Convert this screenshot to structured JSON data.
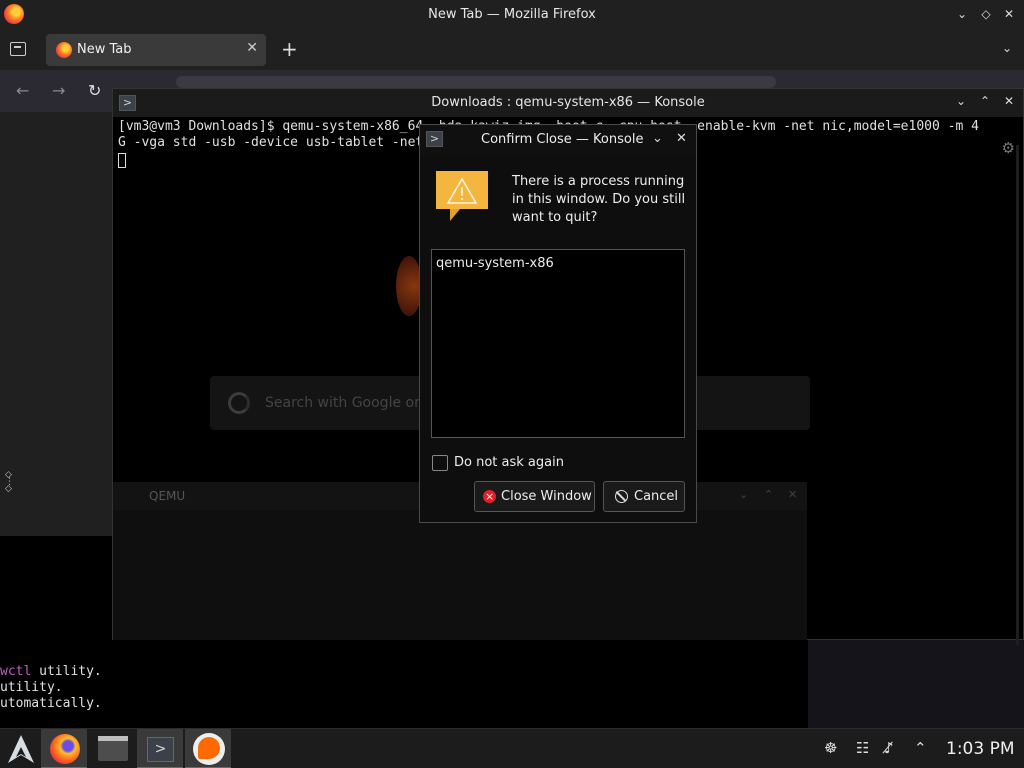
{
  "firefox": {
    "window_title": "New Tab — Mozilla Firefox",
    "controls": {
      "minimize": "⌄",
      "maximize": "◇",
      "close": "✕"
    },
    "tab": {
      "label": "New Tab",
      "close": "✕"
    },
    "new_tab": "+",
    "list_all_tabs": "⌄",
    "nav": {
      "back": "←",
      "forward": "→",
      "reload": "↻"
    },
    "search_placeholder": "Search with Google or"
  },
  "konsole": {
    "title": "Downloads : qemu-system-x86 — Konsole",
    "app_icon": ">",
    "controls": {
      "minimize": "⌄",
      "maximize": "⌃",
      "close": "✕"
    },
    "terminal_lines": [
      "[vm3@vm3 Downloads]$ qemu-system-x86_64 -hda kawiz.img -boot c -cpu host -enable-kvm -net nic,model=e1000 -m 4",
      "G -vga std -usb -device usb-tablet -net"
    ],
    "settings_icon": "⚙"
  },
  "qemu_window": {
    "title": "QEMU",
    "controls": {
      "minimize": "⌄",
      "maximize": "⌃",
      "close": "✕"
    }
  },
  "background_terminal": {
    "lines": [
      {
        "prefix": "wctl",
        "rest": " utility."
      },
      {
        "prefix": "",
        "rest": "utility."
      },
      {
        "prefix": "",
        "rest": "utomatically."
      }
    ]
  },
  "dialog": {
    "title": "Confirm Close — Konsole",
    "app_icon": ">",
    "controls": {
      "minimize": "⌄",
      "close": "✕"
    },
    "message": "There is a process running in this window. Do you still want to quit?",
    "processes": [
      "qemu-system-x86"
    ],
    "checkbox_label": "Do not ask again",
    "checkbox_checked": false,
    "buttons": {
      "close_window": "Close Window",
      "cancel": "Cancel"
    },
    "colors": {
      "warning": "#f5b63f",
      "danger": "#e0202a"
    }
  },
  "taskbar": {
    "apps": [
      {
        "name": "firefox",
        "active": true
      },
      {
        "name": "dolphin",
        "active": false
      },
      {
        "name": "konsole",
        "active": true
      },
      {
        "name": "qemu",
        "active": true
      }
    ],
    "tray": {
      "network": "☸",
      "clipboard": "☷",
      "volume_muted": "♪̸",
      "expand": "⌃"
    },
    "clock": "1:03 PM"
  }
}
